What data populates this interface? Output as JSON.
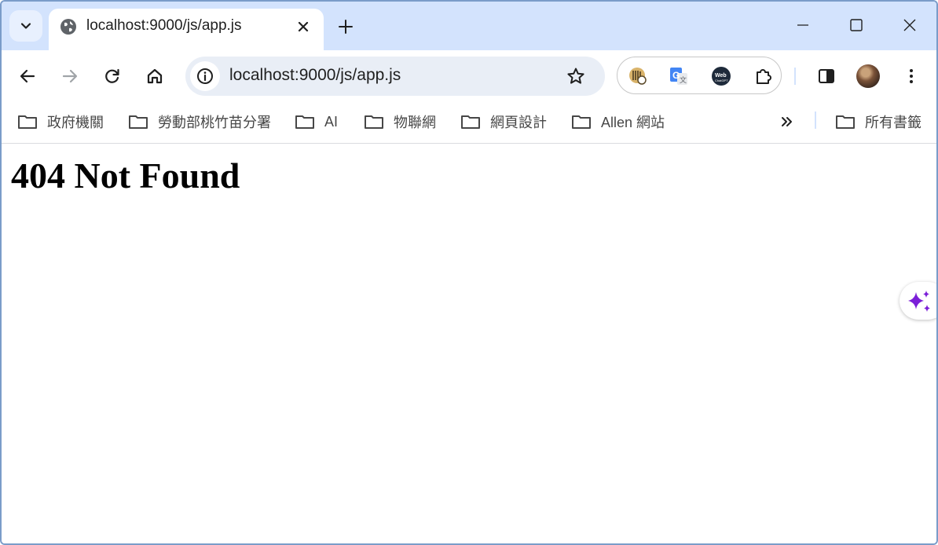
{
  "tab": {
    "title": "localhost:9000/js/app.js",
    "favicon": "globe-icon"
  },
  "omnibox": {
    "url": "localhost:9000/js/app.js"
  },
  "extensions": [
    "kakao-extension-icon",
    "google-translate-icon",
    "webchatgpt-icon",
    "puzzle-extensions-icon"
  ],
  "bookmarks": {
    "items": [
      {
        "label": "政府機關"
      },
      {
        "label": "勞動部桃竹苗分署"
      },
      {
        "label": "AI"
      },
      {
        "label": "物聯網"
      },
      {
        "label": "網頁設計"
      },
      {
        "label": "Allen 網站"
      }
    ],
    "all_label": "所有書籤"
  },
  "page": {
    "heading": "404 Not Found"
  },
  "colors": {
    "tabstrip": "#d3e3fd",
    "omnibox": "#e9eef6",
    "spark": "#7b1fd8"
  }
}
